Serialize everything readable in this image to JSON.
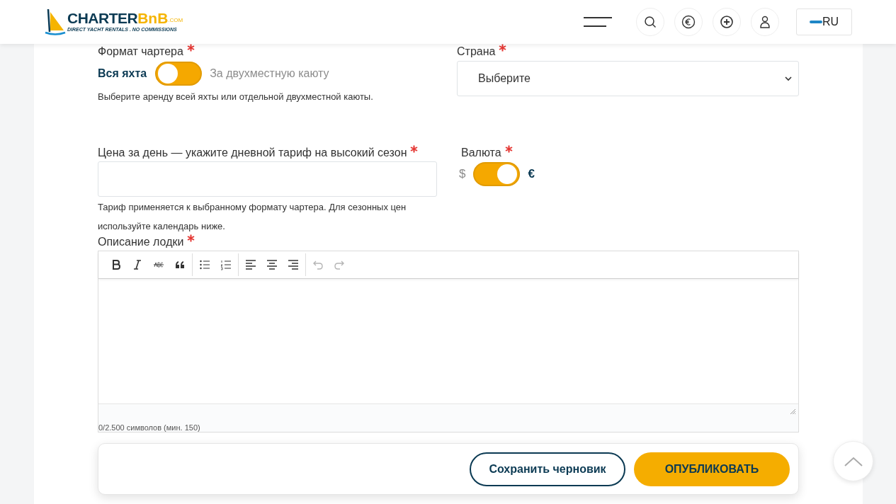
{
  "header": {
    "logo": {
      "name": "CHARTER",
      "accent": "BnB",
      "suffix": ".COM",
      "tagline": "DIRECT YACHT RENTALS . NO COMMISSIONS"
    },
    "language": "RU"
  },
  "form": {
    "charter_format": {
      "label": "Формат чартера",
      "required": true,
      "options": [
        {
          "label": "Вся яхта",
          "selected": true
        },
        {
          "label": "За двухместную каюту",
          "selected": false
        }
      ],
      "help": "Выберите аренду всей яхты или отдельной двухместной каюты."
    },
    "country": {
      "label": "Страна",
      "required": true,
      "value": "Выберите"
    },
    "price": {
      "label": "Цена за день — укажите дневной тариф на высокий сезон",
      "required": true,
      "help": "Тариф применяется к выбранному формату чартера. Для сезонных цен используйте календарь ниже."
    },
    "currency": {
      "label": "Валюта",
      "required": true,
      "options": [
        {
          "label": "$",
          "selected": false
        },
        {
          "label": "€",
          "selected": true
        }
      ]
    },
    "description": {
      "label": "Описание лодки",
      "required": true,
      "toolbar": {
        "undo": {
          "disabled": true
        },
        "redo": {
          "disabled": true
        }
      },
      "counter": "0/2.500 символов (мин. 150)"
    }
  },
  "actions": [
    {
      "label": "Сохранить черновик",
      "kind": "outline"
    },
    {
      "label": "ОПУБЛИКОВАТЬ",
      "kind": "primary"
    }
  ]
}
